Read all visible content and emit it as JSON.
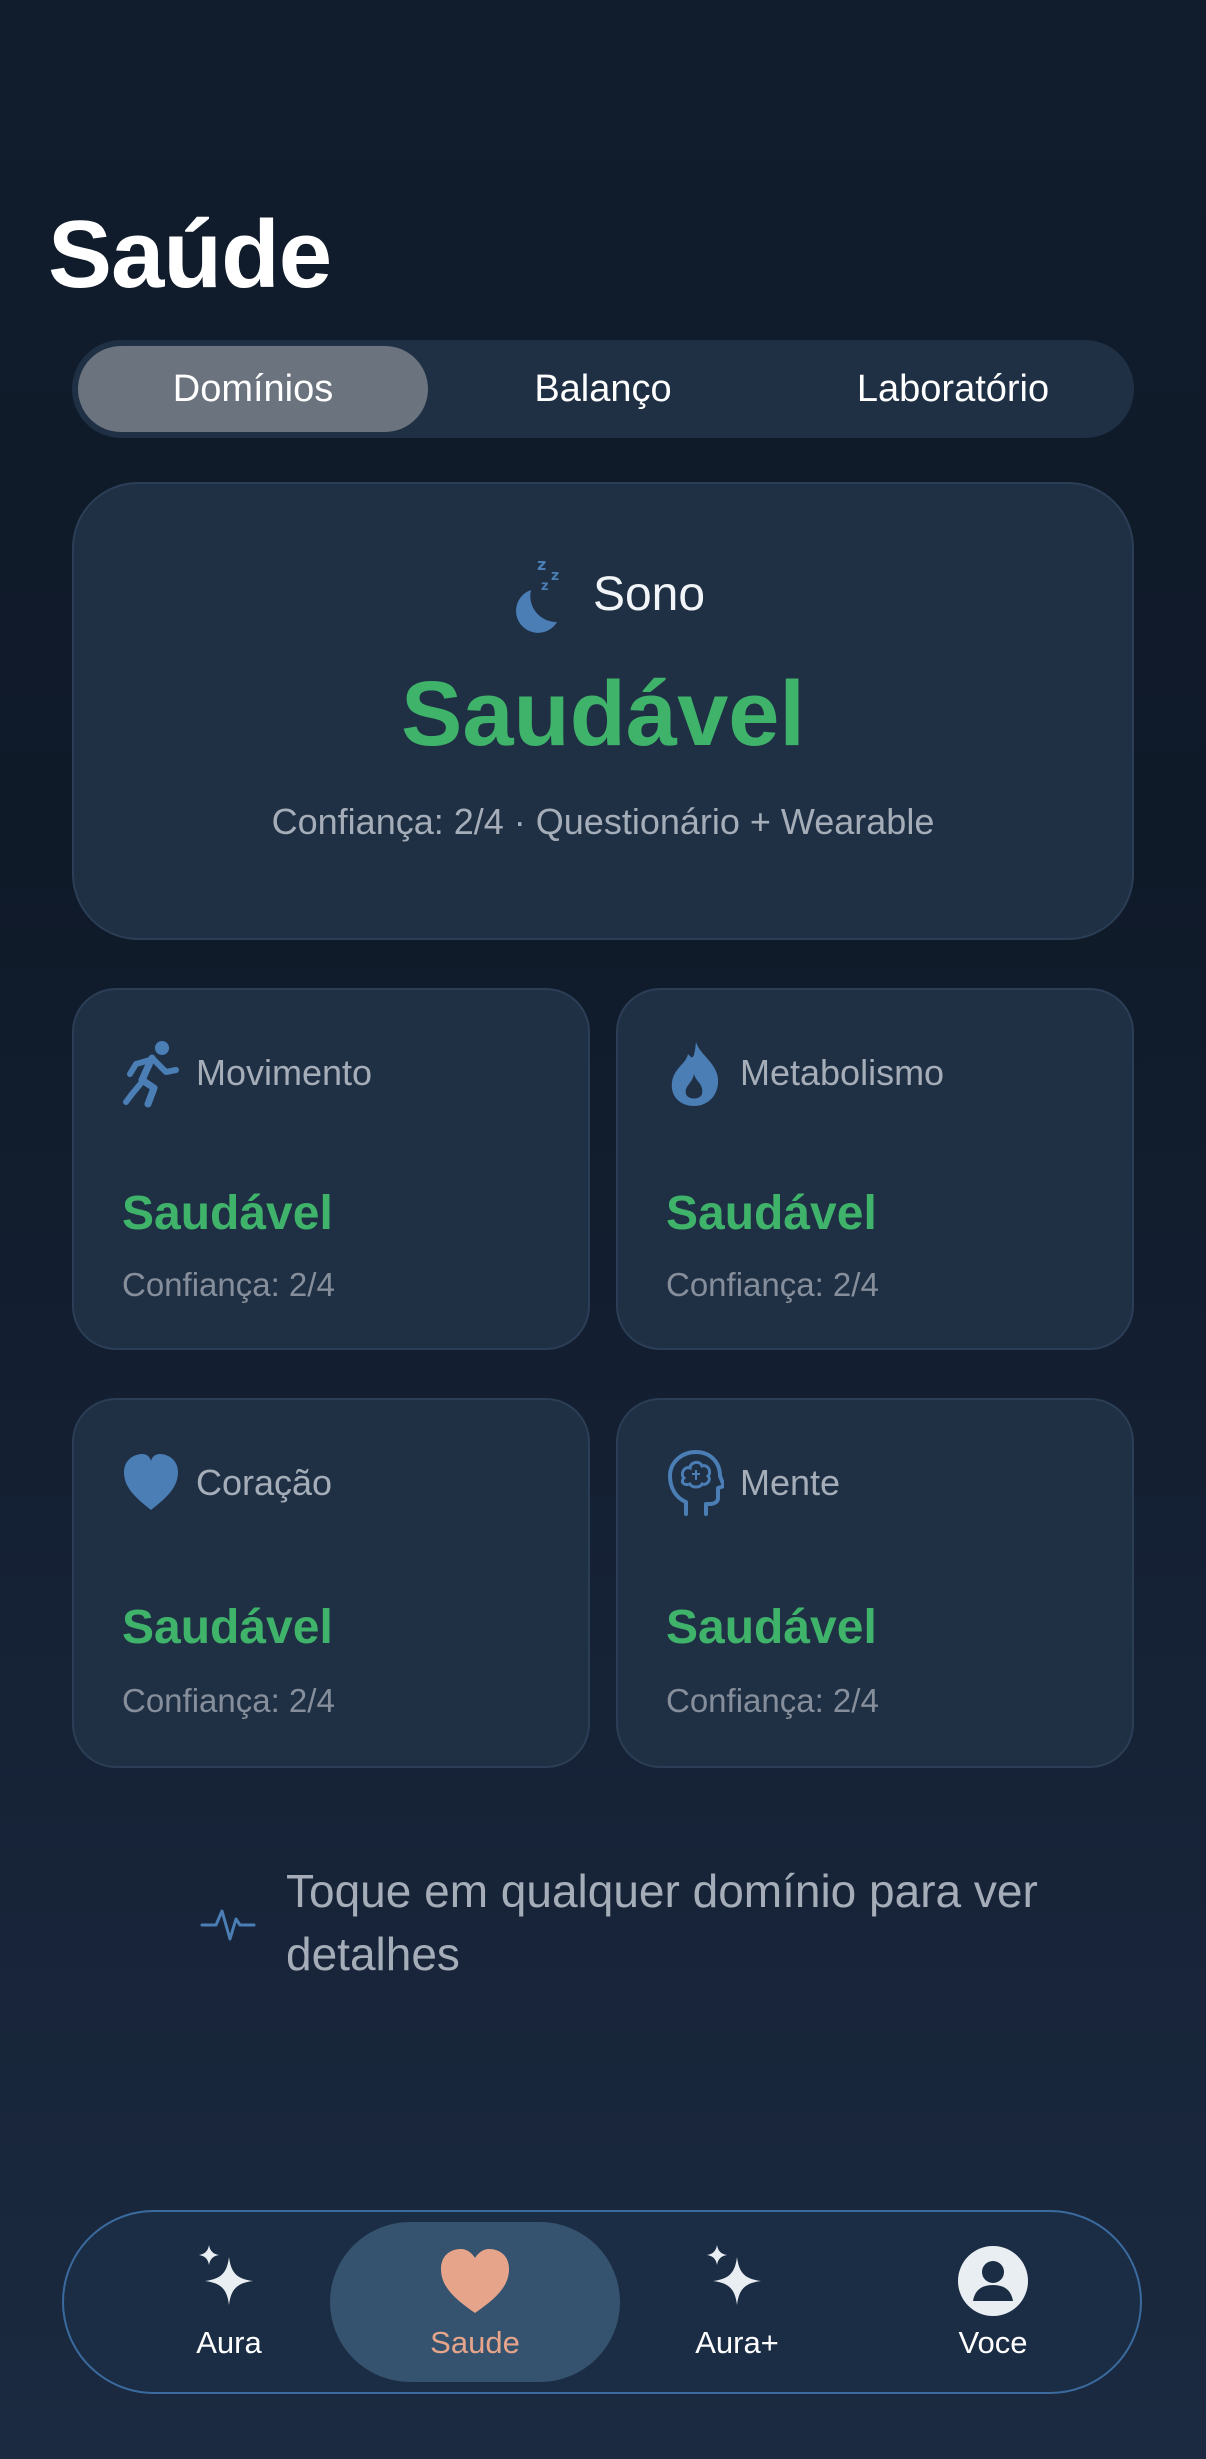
{
  "page": {
    "title": "Saúde"
  },
  "tabs": [
    {
      "label": "Domínios",
      "active": true
    },
    {
      "label": "Balanço",
      "active": false
    },
    {
      "label": "Laboratório",
      "active": false
    }
  ],
  "hero": {
    "icon": "sleep-moon-icon",
    "name": "Sono",
    "status": "Saudável",
    "confidence": "Confiança: 2/4",
    "separator": "·",
    "source": "Questionário + Wearable"
  },
  "domains": [
    {
      "icon": "running-icon",
      "name": "Movimento",
      "status": "Saudável",
      "confidence": "Confiança: 2/4"
    },
    {
      "icon": "flame-icon",
      "name": "Metabolismo",
      "status": "Saudável",
      "confidence": "Confiança: 2/4"
    },
    {
      "icon": "heart-icon",
      "name": "Coração",
      "status": "Saudável",
      "confidence": "Confiança: 2/4"
    },
    {
      "icon": "brain-head-icon",
      "name": "Mente",
      "status": "Saudável",
      "confidence": "Confiança: 2/4"
    }
  ],
  "hint": {
    "icon": "pulse-icon",
    "text": "Toque em qualquer domínio para ver detalhes"
  },
  "nav": [
    {
      "label": "Aura",
      "icon": "sparkles-icon",
      "active": false
    },
    {
      "label": "Saude",
      "icon": "heart-icon",
      "active": true
    },
    {
      "label": "Aura+",
      "icon": "sparkles-icon",
      "active": false
    },
    {
      "label": "Voce",
      "icon": "person-circle-icon",
      "active": false
    }
  ],
  "colors": {
    "accent_green": "#3fb36a",
    "icon_blue": "#4a7eb5",
    "card_bg": "#1f3045",
    "nav_active": "#e6a58a"
  }
}
